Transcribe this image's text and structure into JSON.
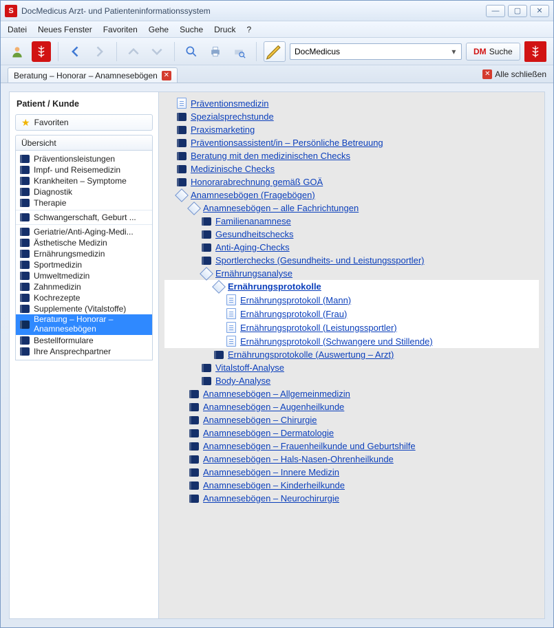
{
  "window": {
    "title": "DocMedicus Arzt- und Patienteninformationssystem"
  },
  "menu": {
    "items": [
      "Datei",
      "Neues Fenster",
      "Favoriten",
      "Gehe",
      "Suche",
      "Druck",
      "?"
    ]
  },
  "toolbar": {
    "search_value": "DocMedicus",
    "dm_label1": "DM",
    "dm_label2": "Suche"
  },
  "tab": {
    "label": "Beratung – Honorar – Anamnesebögen"
  },
  "close_all": "Alle schließen",
  "sidebar": {
    "heading": "Patient / Kunde",
    "favorites": "Favoriten",
    "overview": "Übersicht",
    "items": [
      {
        "label": "Präventionsleistungen",
        "break": false
      },
      {
        "label": "Impf- und Reisemedizin",
        "break": false
      },
      {
        "label": "Krankheiten – Symptome",
        "break": false
      },
      {
        "label": "Diagnostik",
        "break": false
      },
      {
        "label": "Therapie",
        "break": false
      },
      {
        "label": "Schwangerschaft, Geburt ...",
        "break": true
      },
      {
        "label": "Geriatrie/Anti-Aging-Medi...",
        "break": true
      },
      {
        "label": "Ästhetische Medizin",
        "break": false
      },
      {
        "label": "Ernährungsmedizin",
        "break": false
      },
      {
        "label": "Sportmedizin",
        "break": false
      },
      {
        "label": "Umweltmedizin",
        "break": false
      },
      {
        "label": "Zahnmedizin",
        "break": false
      },
      {
        "label": "Kochrezepte",
        "break": false
      },
      {
        "label": "Supplemente (Vitalstoffe)",
        "break": false
      },
      {
        "label": "Beratung – Honorar – Anamnesebögen",
        "break": false,
        "selected": true,
        "twoline": true
      },
      {
        "label": "Bestellformulare",
        "break": false
      },
      {
        "label": "Ihre Ansprechpartner",
        "break": false
      }
    ]
  },
  "tree": [
    {
      "icon": "doc",
      "indent": 1,
      "label": "Präventionsmedizin"
    },
    {
      "icon": "book",
      "indent": 1,
      "label": "Spezialsprechstunde"
    },
    {
      "icon": "book",
      "indent": 1,
      "label": "Praxismarketing"
    },
    {
      "icon": "book",
      "indent": 1,
      "label": "Präventionsassistent/in – Persönliche Betreuung"
    },
    {
      "icon": "book",
      "indent": 1,
      "label": "Beratung mit den medizinischen Checks"
    },
    {
      "icon": "book",
      "indent": 1,
      "label": "Medizinische Checks"
    },
    {
      "icon": "book",
      "indent": 1,
      "label": "Honorarabrechnung gemäß GOÄ"
    },
    {
      "icon": "diamond",
      "indent": 1,
      "label": "Anamnesebögen (Fragebögen)"
    },
    {
      "icon": "diamond",
      "indent": 2,
      "label": "Anamnesebögen – alle Fachrichtungen"
    },
    {
      "icon": "book",
      "indent": 3,
      "label": "Familienanamnese"
    },
    {
      "icon": "book",
      "indent": 3,
      "label": "Gesundheitschecks"
    },
    {
      "icon": "book",
      "indent": 3,
      "label": "Anti-Aging-Checks"
    },
    {
      "icon": "book",
      "indent": 3,
      "label": "Sportlerchecks (Gesundheits- und Leistungssportler)"
    },
    {
      "icon": "diamond",
      "indent": 3,
      "label": "Ernährungsanalyse"
    },
    {
      "icon": "diamond",
      "indent": 4,
      "label": "Ernährungsprotokolle",
      "hl": true,
      "bold": true
    },
    {
      "icon": "doc",
      "indent": 5,
      "label": "Ernährungsprotokoll (Mann)",
      "hl": true
    },
    {
      "icon": "doc",
      "indent": 5,
      "label": "Ernährungsprotokoll (Frau)",
      "hl": true
    },
    {
      "icon": "doc",
      "indent": 5,
      "label": "Ernährungsprotokoll (Leistungssportler)",
      "hl": true
    },
    {
      "icon": "doc",
      "indent": 5,
      "label": "Ernährungsprotokoll (Schwangere und Stillende)",
      "hl": true
    },
    {
      "icon": "book",
      "indent": 4,
      "label": "Ernährungsprotokolle (Auswertung – Arzt)"
    },
    {
      "icon": "book",
      "indent": 3,
      "label": "Vitalstoff-Analyse"
    },
    {
      "icon": "book",
      "indent": 3,
      "label": "Body-Analyse"
    },
    {
      "icon": "book",
      "indent": 2,
      "label": "Anamnesebögen – Allgemeinmedizin"
    },
    {
      "icon": "book",
      "indent": 2,
      "label": "Anamnesebögen – Augenheilkunde"
    },
    {
      "icon": "book",
      "indent": 2,
      "label": "Anamnesebögen – Chirurgie"
    },
    {
      "icon": "book",
      "indent": 2,
      "label": "Anamnesebögen – Dermatologie"
    },
    {
      "icon": "book",
      "indent": 2,
      "label": "Anamnesebögen – Frauenheilkunde und Geburtshilfe"
    },
    {
      "icon": "book",
      "indent": 2,
      "label": "Anamnesebögen – Hals-Nasen-Ohrenheilkunde"
    },
    {
      "icon": "book",
      "indent": 2,
      "label": "Anamnesebögen – Innere Medizin"
    },
    {
      "icon": "book",
      "indent": 2,
      "label": "Anamnesebögen – Kinderheilkunde"
    },
    {
      "icon": "book",
      "indent": 2,
      "label": "Anamnesebögen – Neurochirurgie"
    }
  ]
}
